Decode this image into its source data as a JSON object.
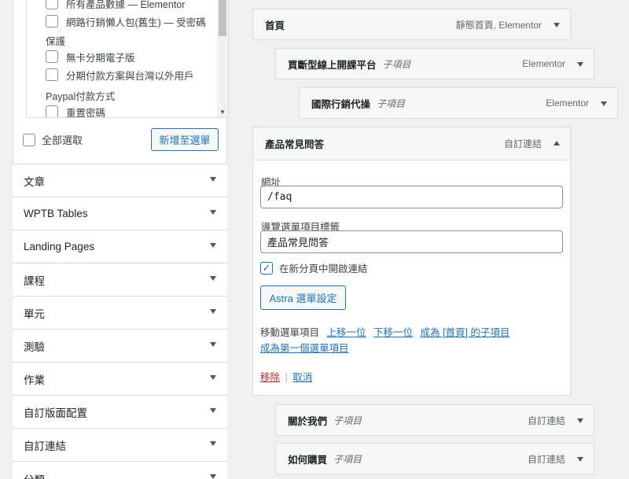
{
  "left_panel": {
    "items": [
      {
        "label": "所有產品數據 — Elementor",
        "checked": false
      },
      {
        "label": "網路行銷懶人包(舊生) — 受密碼",
        "checked": false
      }
    ],
    "group1": "保護",
    "items2": [
      {
        "label": "無卡分期電子版",
        "checked": false
      },
      {
        "label": "分期付款方案與台灣以外用戶",
        "checked": false
      }
    ],
    "group2": "Paypal付款方式",
    "items3": [
      {
        "label": "重置密碼",
        "checked": false
      }
    ],
    "select_all_label": "全部選取",
    "add_to_menu_label": "新增至選單",
    "accordions": [
      "文章",
      "WPTB Tables",
      "Landing Pages",
      "課程",
      "單元",
      "測驗",
      "作業",
      "自訂版面配置",
      "自訂連結",
      "分類"
    ]
  },
  "menu_items": [
    {
      "title": "首頁",
      "subtitle": "",
      "type": "靜態首頁, Elementor"
    },
    {
      "title": "買斷型線上開課平台",
      "subtitle": "子項目",
      "type": "Elementor"
    },
    {
      "title": "國際行銷代操",
      "subtitle": "子項目",
      "type": "Elementor"
    },
    {
      "title": "關於我們",
      "subtitle": "子項目",
      "type": "自訂連結"
    },
    {
      "title": "如何購買",
      "subtitle": "子項目",
      "type": "自訂連結"
    }
  ],
  "open_item": {
    "title": "產品常見問答",
    "type": "自訂連結",
    "url_label": "網址",
    "url_value": "/faq",
    "nav_label_label": "導覽選單項目標籤",
    "nav_label_value": "產品常見問答",
    "new_tab_label": "在新分頁中開啟連結",
    "new_tab_checked": true,
    "astra_button": "Astra 選單設定",
    "move_label": "移動選單項目",
    "move_up": "上移一位",
    "move_down": "下移一位",
    "move_under": "成為 [首頁] 的子項目",
    "move_top": "成為第一個選單項目",
    "remove": "移除",
    "separator": "|",
    "cancel": "取消"
  },
  "colors": {
    "accent": "#2271b1",
    "danger": "#b32d2e",
    "border": "#dcdcde",
    "background": "#f0f0f1"
  }
}
